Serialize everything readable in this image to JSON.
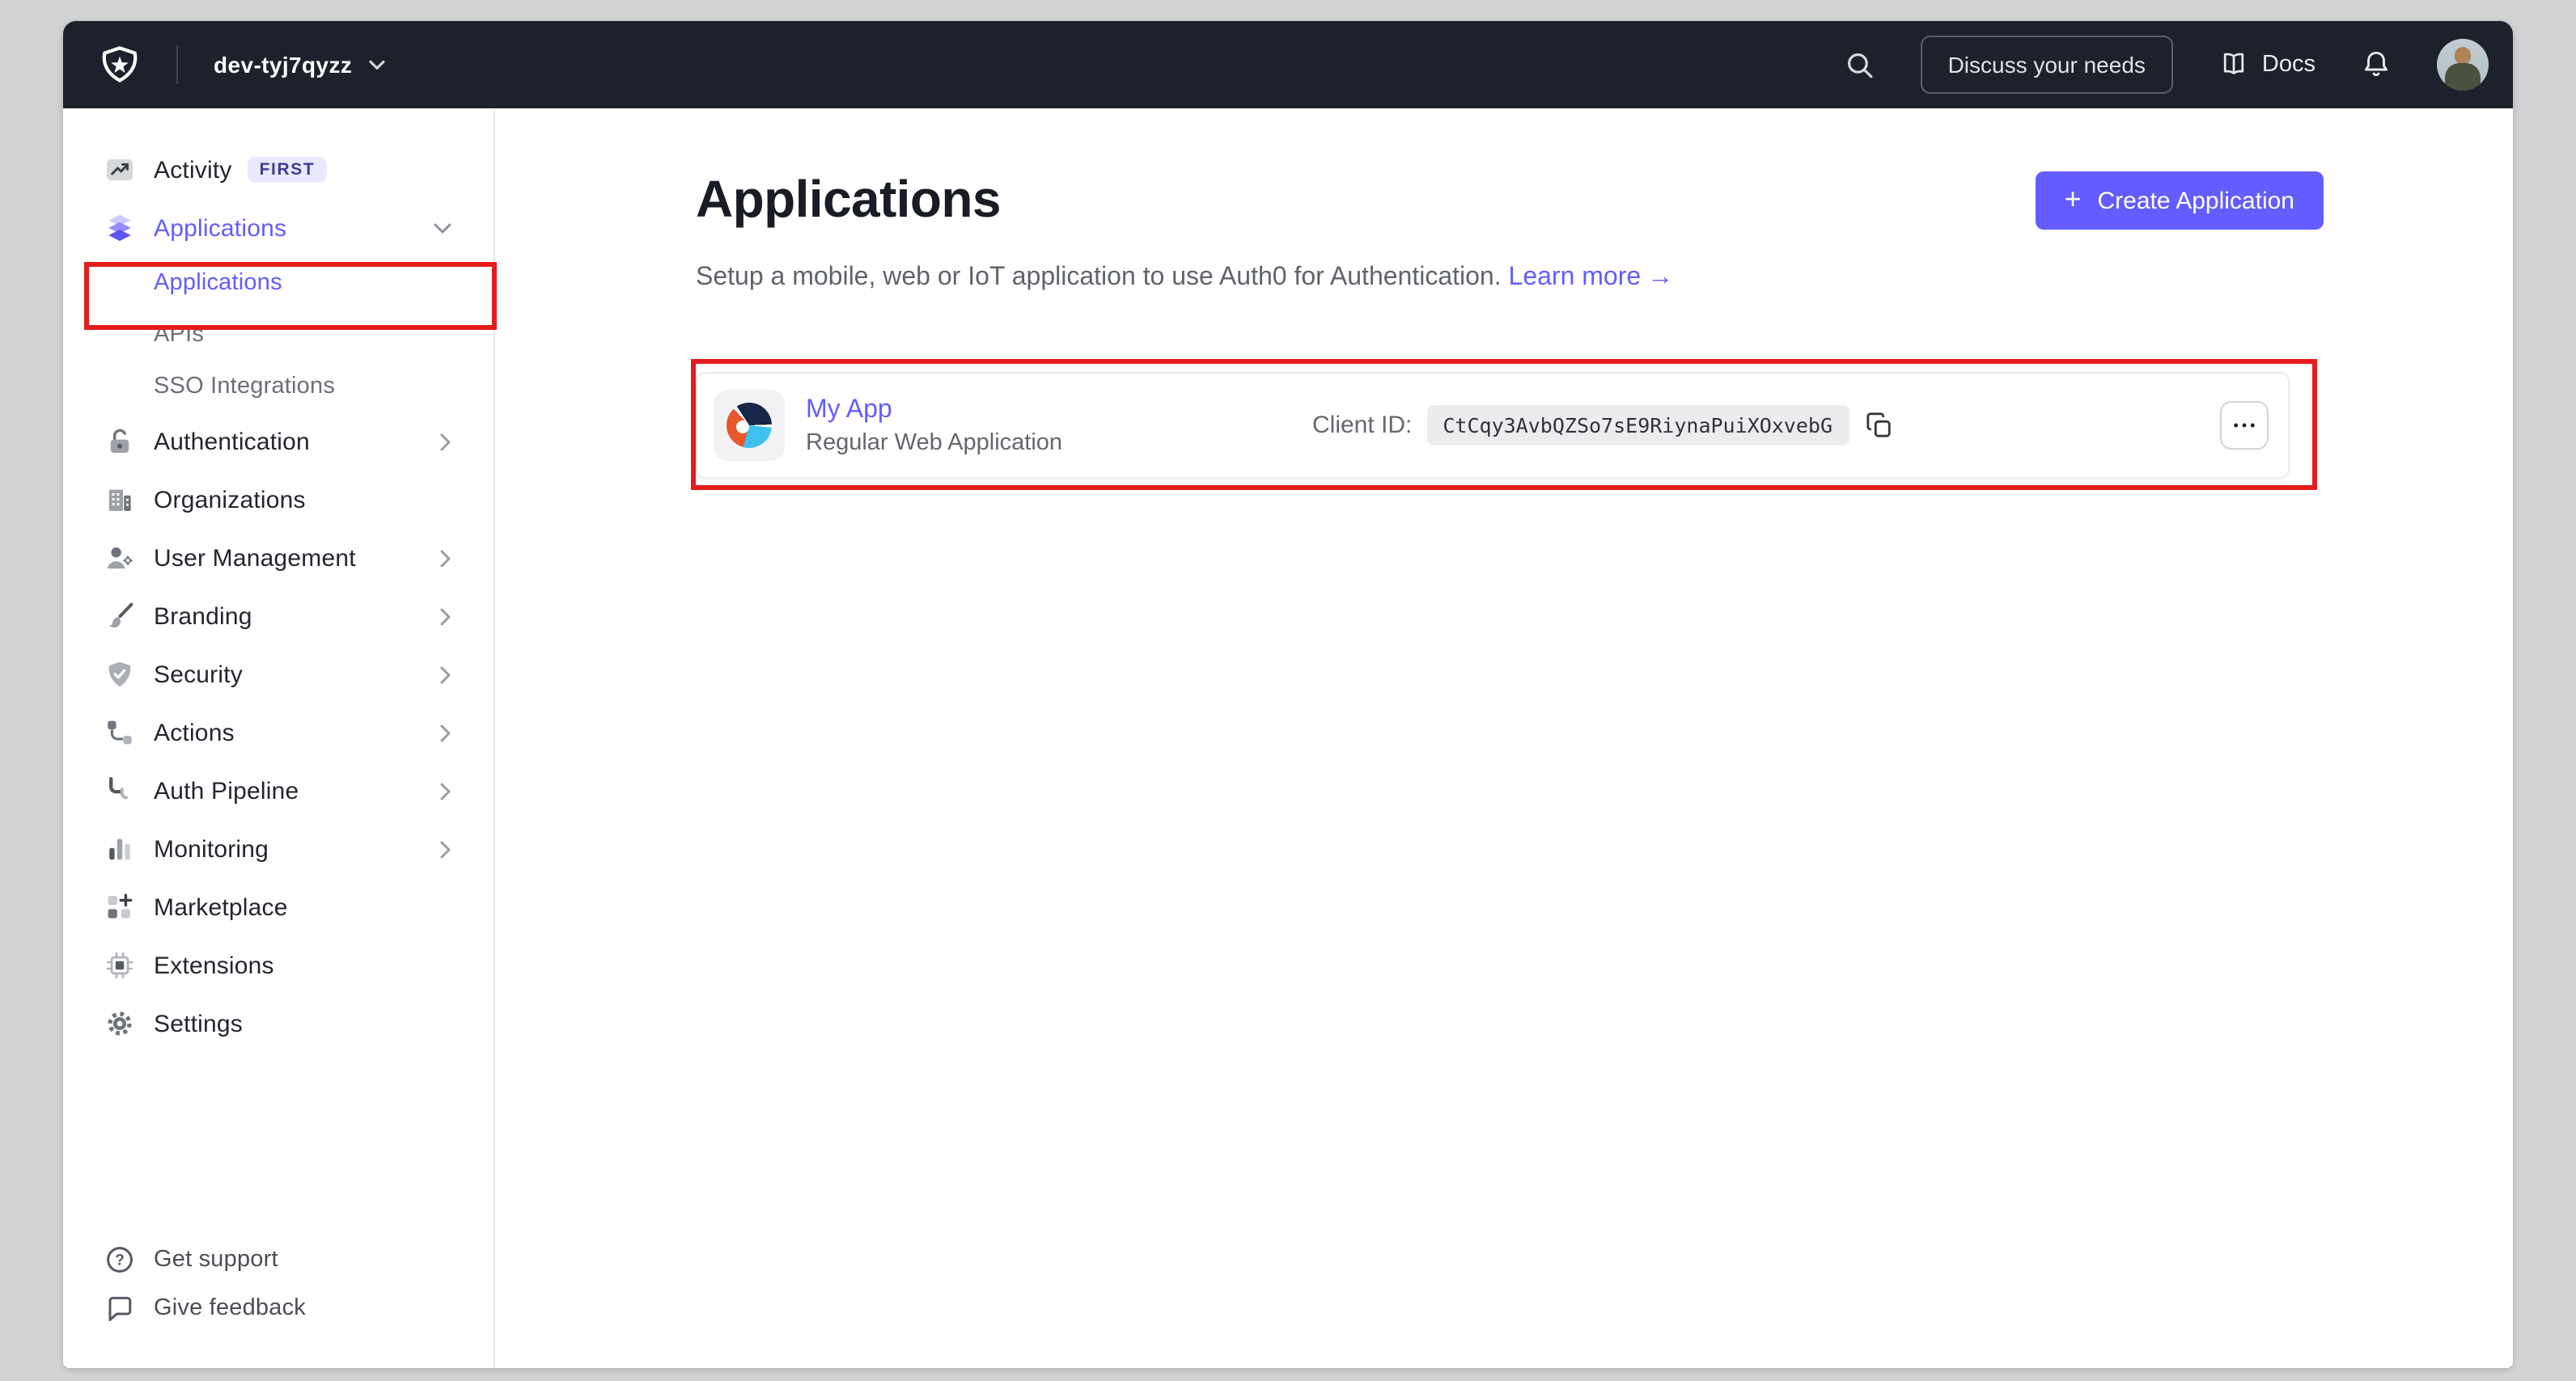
{
  "topbar": {
    "tenant": "dev-tyj7qyzz",
    "discuss_button": "Discuss your needs",
    "docs_label": "Docs"
  },
  "sidebar": {
    "activity": {
      "label": "Activity",
      "badge": "FIRST"
    },
    "applications_group": {
      "label": "Applications",
      "children": [
        {
          "label": "Applications",
          "active": true
        },
        {
          "label": "APIs",
          "active": false
        },
        {
          "label": "SSO Integrations",
          "active": false
        }
      ]
    },
    "items": [
      {
        "label": "Authentication",
        "chevron": true
      },
      {
        "label": "Organizations",
        "chevron": false
      },
      {
        "label": "User Management",
        "chevron": true
      },
      {
        "label": "Branding",
        "chevron": true
      },
      {
        "label": "Security",
        "chevron": true
      },
      {
        "label": "Actions",
        "chevron": true
      },
      {
        "label": "Auth Pipeline",
        "chevron": true
      },
      {
        "label": "Monitoring",
        "chevron": true
      },
      {
        "label": "Marketplace",
        "chevron": false
      },
      {
        "label": "Extensions",
        "chevron": false
      },
      {
        "label": "Settings",
        "chevron": false
      }
    ],
    "footer": [
      {
        "label": "Get support"
      },
      {
        "label": "Give feedback"
      }
    ]
  },
  "main": {
    "title": "Applications",
    "subtitle": "Setup a mobile, web or IoT application to use Auth0 for Authentication.",
    "learn_more": "Learn more",
    "learn_more_arrow": "→",
    "create_button": "Create Application",
    "create_plus": "+"
  },
  "app_card": {
    "name": "My App",
    "type": "Regular Web Application",
    "client_id_label": "Client ID:",
    "client_id": "CtCqy3AvbQZSo7sE9RiynaPuiXOxvebG",
    "menu_glyph": "•••"
  },
  "icons": {
    "auth0-logo": "shield-star",
    "search-icon": "magnifier",
    "docs-icon": "open-book",
    "notifications-icon": "bell",
    "copy-icon": "overlapping-squares",
    "menu-icon": "ellipsis"
  },
  "colors": {
    "accent": "#635dff",
    "annotation": "#e51c1c",
    "topbar_bg": "#1d212b",
    "canvas_bg": "#d2d3d5"
  }
}
